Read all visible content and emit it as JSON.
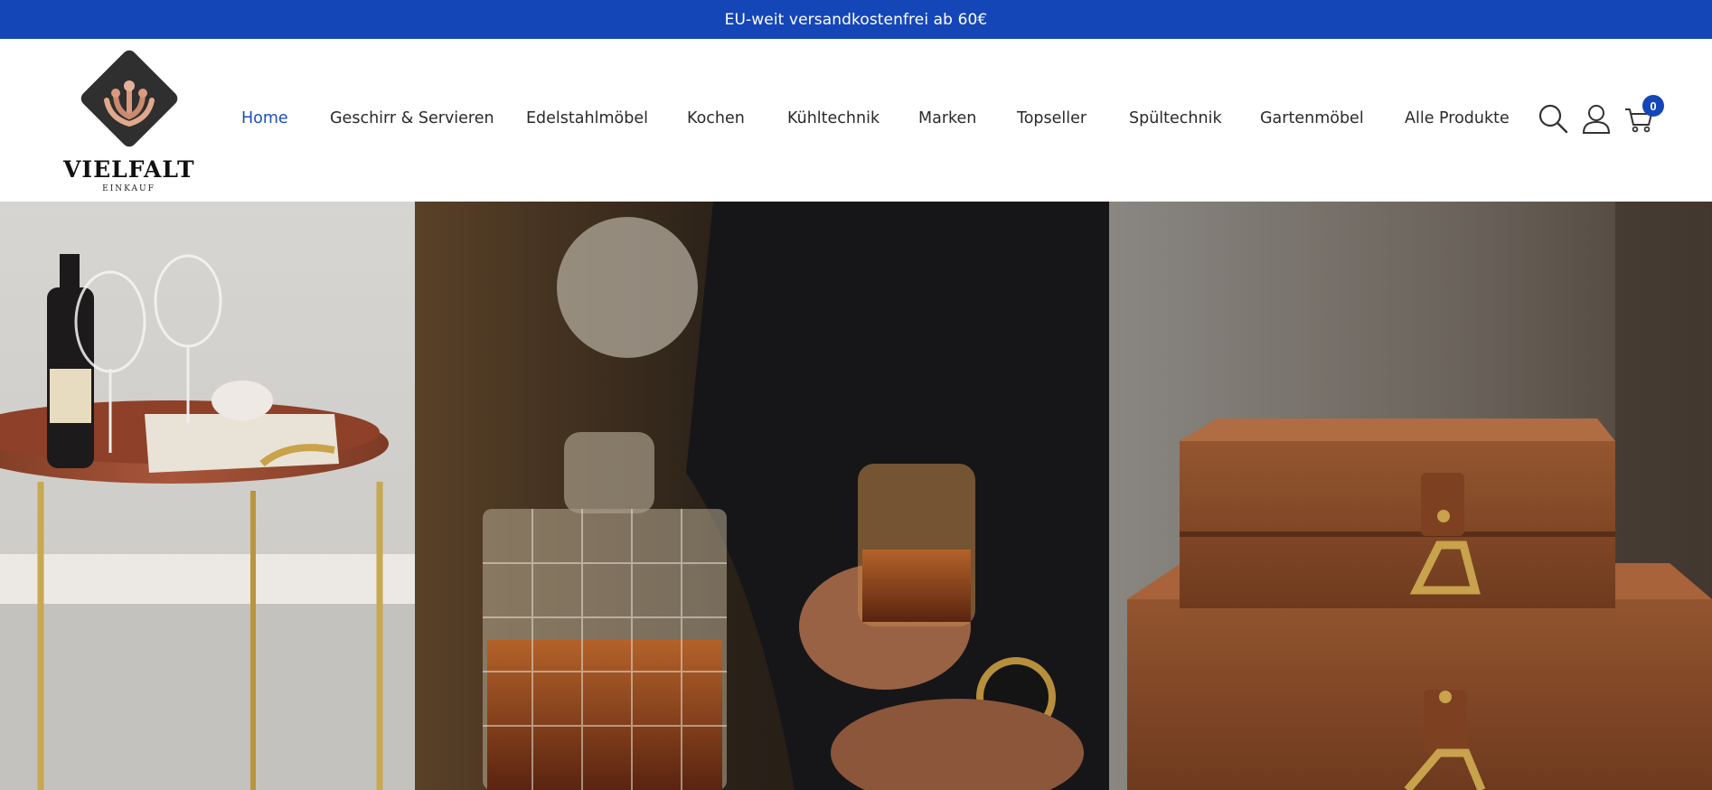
{
  "announcement": {
    "text": "EU-weit versandkostenfrei ab 60€"
  },
  "brand": {
    "name": "VIELFALT",
    "tagline": "EINKAUF"
  },
  "nav": {
    "items": [
      {
        "label": "Home",
        "active": true
      },
      {
        "label": "Geschirr & Servieren"
      },
      {
        "label": "Edelstahlmöbel"
      },
      {
        "label": "Kochen"
      },
      {
        "label": "Kühltechnik"
      },
      {
        "label": "Marken"
      },
      {
        "label": "Topseller"
      },
      {
        "label": "Spültechnik"
      },
      {
        "label": "Gartenmöbel"
      },
      {
        "label": "Alle Produkte"
      }
    ]
  },
  "header_icons": {
    "search": "search-icon",
    "account": "user-icon",
    "cart": "cart-icon",
    "cart_count": "0"
  },
  "colors": {
    "accent": "#1546b8",
    "active_link": "#1a4fb8",
    "text": "#2a2a2a"
  }
}
